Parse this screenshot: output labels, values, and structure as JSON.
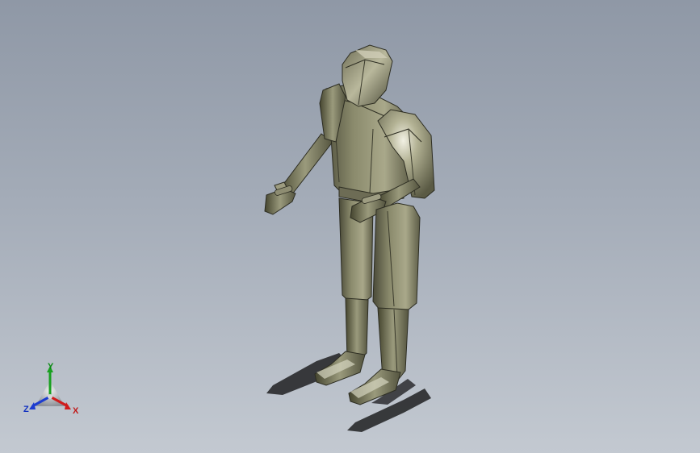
{
  "viewport": {
    "background_top": "#8f98a6",
    "background_bottom": "#c3c9d1"
  },
  "model": {
    "body_color": "#7d7c62",
    "highlight_color": "#e4e3d4",
    "shadow_color": "#2b2c2f"
  },
  "triad": {
    "x_label": "X",
    "y_label": "Y",
    "z_label": "Z",
    "x_color": "#d01c1c",
    "y_color": "#18a020",
    "z_color": "#1c3cd0"
  }
}
